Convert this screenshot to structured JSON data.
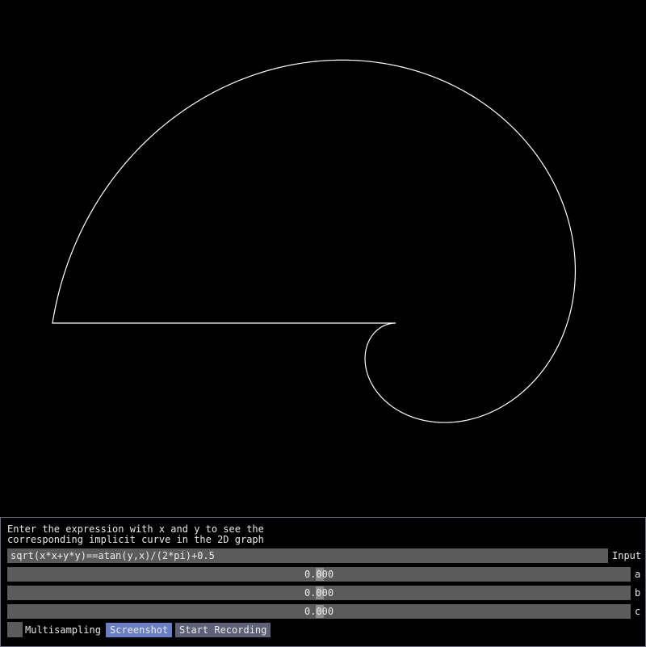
{
  "graph": {
    "curve_color": "#ffffff",
    "background_color": "#000000"
  },
  "panel": {
    "help_line1": "Enter the expression with x and y to see the",
    "help_line2": "corresponding implicit curve in the 2D graph",
    "expression_value": "sqrt(x*x+y*y)==atan(y,x)/(2*pi)+0.5",
    "expression_label": "Input",
    "sliders": [
      {
        "label": "a",
        "value": "0.000"
      },
      {
        "label": "b",
        "value": "0.000"
      },
      {
        "label": "c",
        "value": "0.000"
      }
    ],
    "multisampling_label": "Multisampling",
    "multisampling_checked": false,
    "screenshot_label": "Screenshot",
    "recording_label": "Start Recording",
    "accent_color": "#6b7fc4"
  }
}
